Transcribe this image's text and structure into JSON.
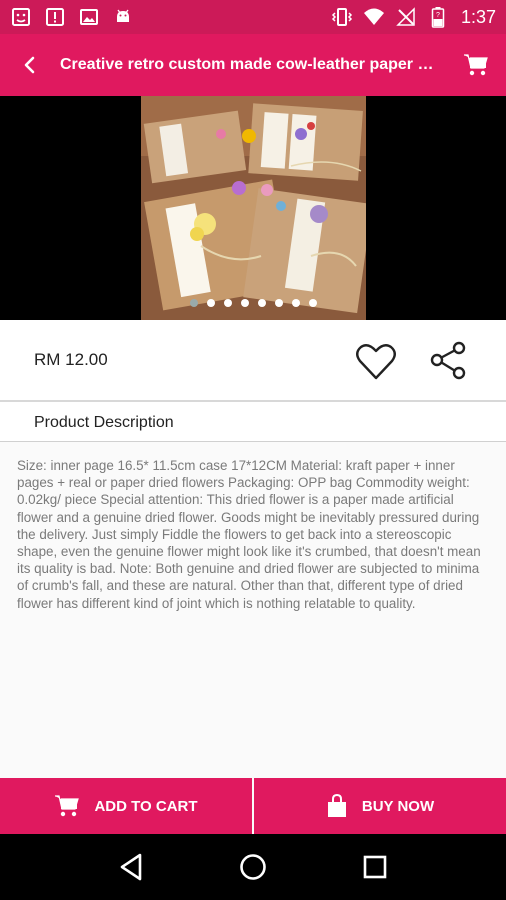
{
  "status_bar": {
    "time": "1:37",
    "left_icons": [
      "screenshot-icon",
      "alert-icon",
      "image-icon",
      "android-icon"
    ],
    "right_icons": [
      "vibrate-icon",
      "wifi-icon",
      "no-signal-icon",
      "battery-icon"
    ]
  },
  "app_bar": {
    "title": "Creative retro custom made cow-leather paper h...",
    "back_icon": "back-arrow-icon",
    "cart_icon": "cart-icon"
  },
  "gallery": {
    "image_count": 8,
    "active_index": 0
  },
  "product": {
    "price": "RM 12.00"
  },
  "description": {
    "header": "Product Description",
    "text": "Size: inner page 16.5* 11.5cm case 17*12CM Material: kraft paper + inner pages + real or paper dried flowers Packaging: OPP bag Commodity weight: 0.02kg/ piece Special attention: This dried flower is a paper made artificial flower and a genuine dried flower. Goods might be inevitably pressured during the delivery. Just simply Fiddle the flowers to get back into a stereoscopic shape, even the genuine flower might look like it's crumbed, that doesn't mean its quality is bad. Note: Both genuine and dried flower are subjected to minima of crumb's fall, and these are natural. Other than that, different type of dried flower has different kind of joint which is nothing relatable to quality."
  },
  "actions": {
    "add_to_cart": "ADD TO CART",
    "buy_now": "BUY NOW"
  },
  "colors": {
    "status_bar": "#cc1a58",
    "primary": "#e0195f",
    "text_gray": "#7a7a7a"
  }
}
